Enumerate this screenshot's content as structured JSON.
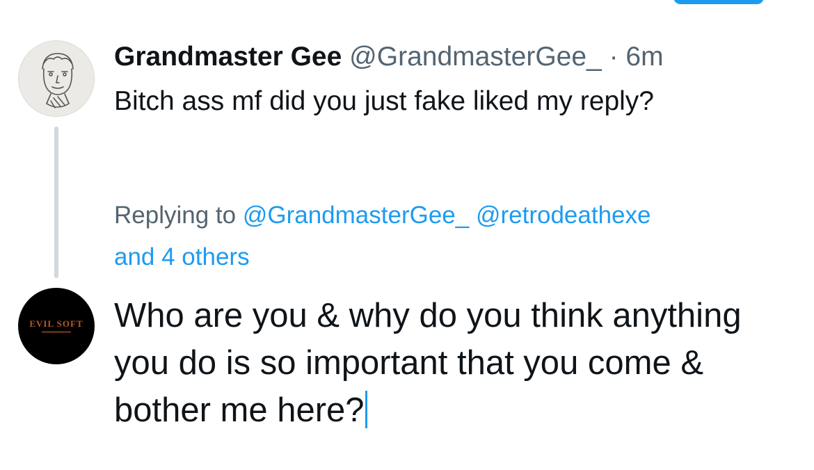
{
  "tweet": {
    "display_name": "Grandmaster Gee",
    "handle": "@GrandmasterGee_",
    "separator": "·",
    "time": "6m",
    "text": "Bitch ass mf did you just fake liked my reply?"
  },
  "reply": {
    "prefix": "Replying to",
    "mention_1": "@GrandmasterGee_",
    "mention_2": "@retrodeathexe",
    "others": "and 4 others"
  },
  "compose": {
    "text": "Who are you & why do you think anything you do is so important that you come & bother me here?",
    "avatar_logo": "EVIL SOFT"
  },
  "colors": {
    "accent": "#1d9bf0",
    "secondary_text": "#536471",
    "primary_text": "#0f1419",
    "thread_line": "#cfd9de"
  }
}
